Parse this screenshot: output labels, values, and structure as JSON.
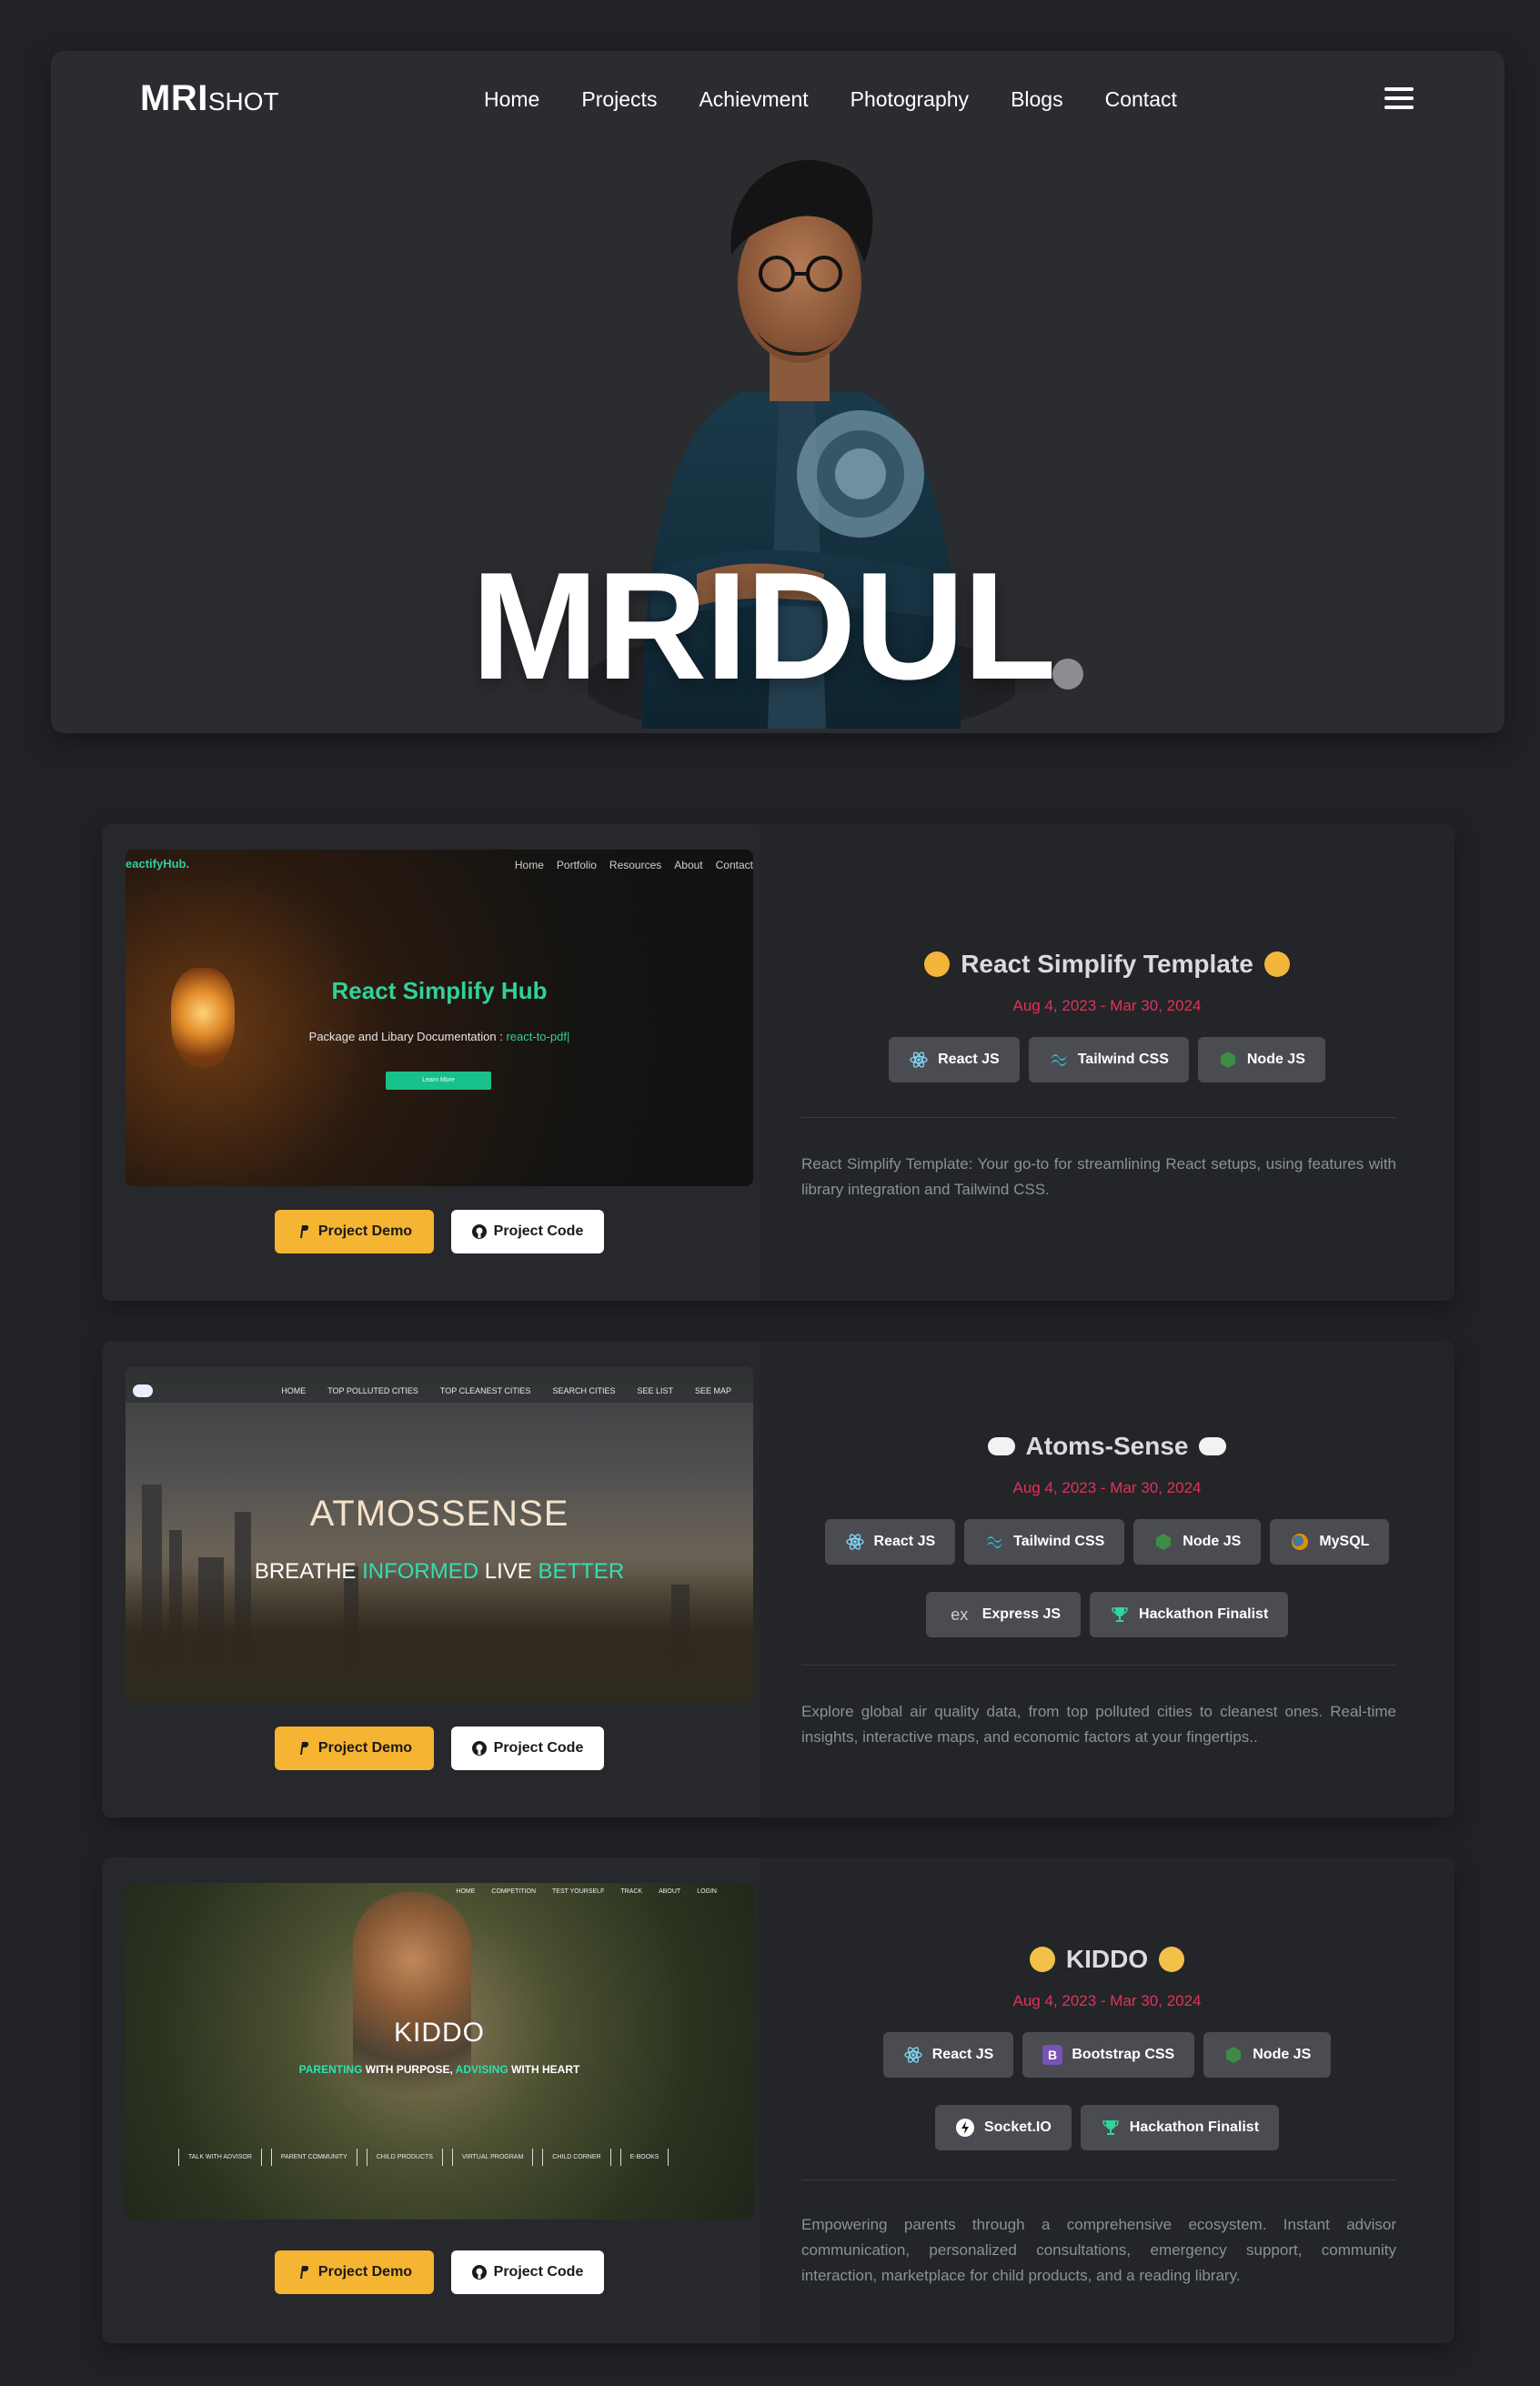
{
  "brand": {
    "bold": "MRI",
    "light": "SHOT"
  },
  "nav": [
    "Home",
    "Projects",
    "Achievment",
    "Photography",
    "Blogs",
    "Contact"
  ],
  "hero": {
    "name": "MRIDUL"
  },
  "buttons": {
    "demo": "Project Demo",
    "code": "Project Code"
  },
  "colors": {
    "accent": "#f5b431",
    "date": "#e1325a",
    "background": "#202226",
    "tag": "#4a4c51"
  },
  "projects": [
    {
      "title": "React Simplify Template",
      "date": "Aug 4, 2023 - Mar 30, 2024",
      "tags": [
        {
          "label": "React JS",
          "icon": "react-icon"
        },
        {
          "label": "Tailwind CSS",
          "icon": "tailwind-icon"
        },
        {
          "label": "Node JS",
          "icon": "nodejs-icon"
        }
      ],
      "description": "React Simplify Template: Your go-to for streamlining React setups, using features with library integration and Tailwind CSS.",
      "preview": {
        "logo": "eactifyHub.",
        "nav": [
          "Home",
          "Portfolio",
          "Resources",
          "About",
          "Contact"
        ],
        "title": "React Simplify Hub",
        "subtitle": "Package and Libary Documentation :",
        "subtitle_highlight": "react-to-pdf|",
        "button": "Learn More"
      }
    },
    {
      "title": "Atoms-Sense",
      "date": "Aug 4, 2023 - Mar 30, 2024",
      "tags": [
        {
          "label": "React JS",
          "icon": "react-icon"
        },
        {
          "label": "Tailwind CSS",
          "icon": "tailwind-icon"
        },
        {
          "label": "Node JS",
          "icon": "nodejs-icon"
        },
        {
          "label": "MySQL",
          "icon": "mysql-icon"
        },
        {
          "label": "Express JS",
          "icon": "express-icon"
        },
        {
          "label": "Hackathon Finalist",
          "icon": "trophy-icon"
        }
      ],
      "description": "Explore global air quality data, from top polluted cities to cleanest ones. Real-time insights, interactive maps, and economic factors at your fingertips..",
      "preview": {
        "nav": [
          "HOME",
          "TOP POLLUTED CITIES",
          "TOP CLEANEST CITIES",
          "SEARCH CITIES",
          "SEE LIST",
          "SEE MAP"
        ],
        "title": "ATMOSSENSE",
        "subtitle_parts": [
          "BREATHE ",
          "INFORMED",
          " LIVE ",
          "BETTER"
        ]
      }
    },
    {
      "title": "KIDDO",
      "date": "Aug 4, 2023 - Mar 30, 2024",
      "tags": [
        {
          "label": "React JS",
          "icon": "react-icon"
        },
        {
          "label": "Bootstrap CSS",
          "icon": "bootstrap-icon"
        },
        {
          "label": "Node JS",
          "icon": "nodejs-icon"
        },
        {
          "label": "Socket.IO",
          "icon": "socketio-icon"
        },
        {
          "label": "Hackathon Finalist",
          "icon": "trophy-icon"
        }
      ],
      "description": "Empowering parents through a comprehensive ecosystem. Instant advisor communication, personalized consultations, emergency support, community interaction, marketplace for child products, and a reading library.",
      "preview": {
        "nav": [
          "HOME",
          "COMPETITION",
          "TEST YOURSELF",
          "TRACK",
          "ABOUT",
          "LOGIN"
        ],
        "title": "KIDDO",
        "subtitle_parts": [
          "PARENTING",
          " WITH PURPOSE, ",
          "ADVISING",
          " WITH HEART"
        ],
        "links": [
          "TALK WITH ADVISOR",
          "PARENT COMMUNITY",
          "CHILD PRODUCTS",
          "VIRTUAL PROGRAM",
          "CHILD CORNER",
          "E-BOOKS"
        ]
      }
    }
  ]
}
